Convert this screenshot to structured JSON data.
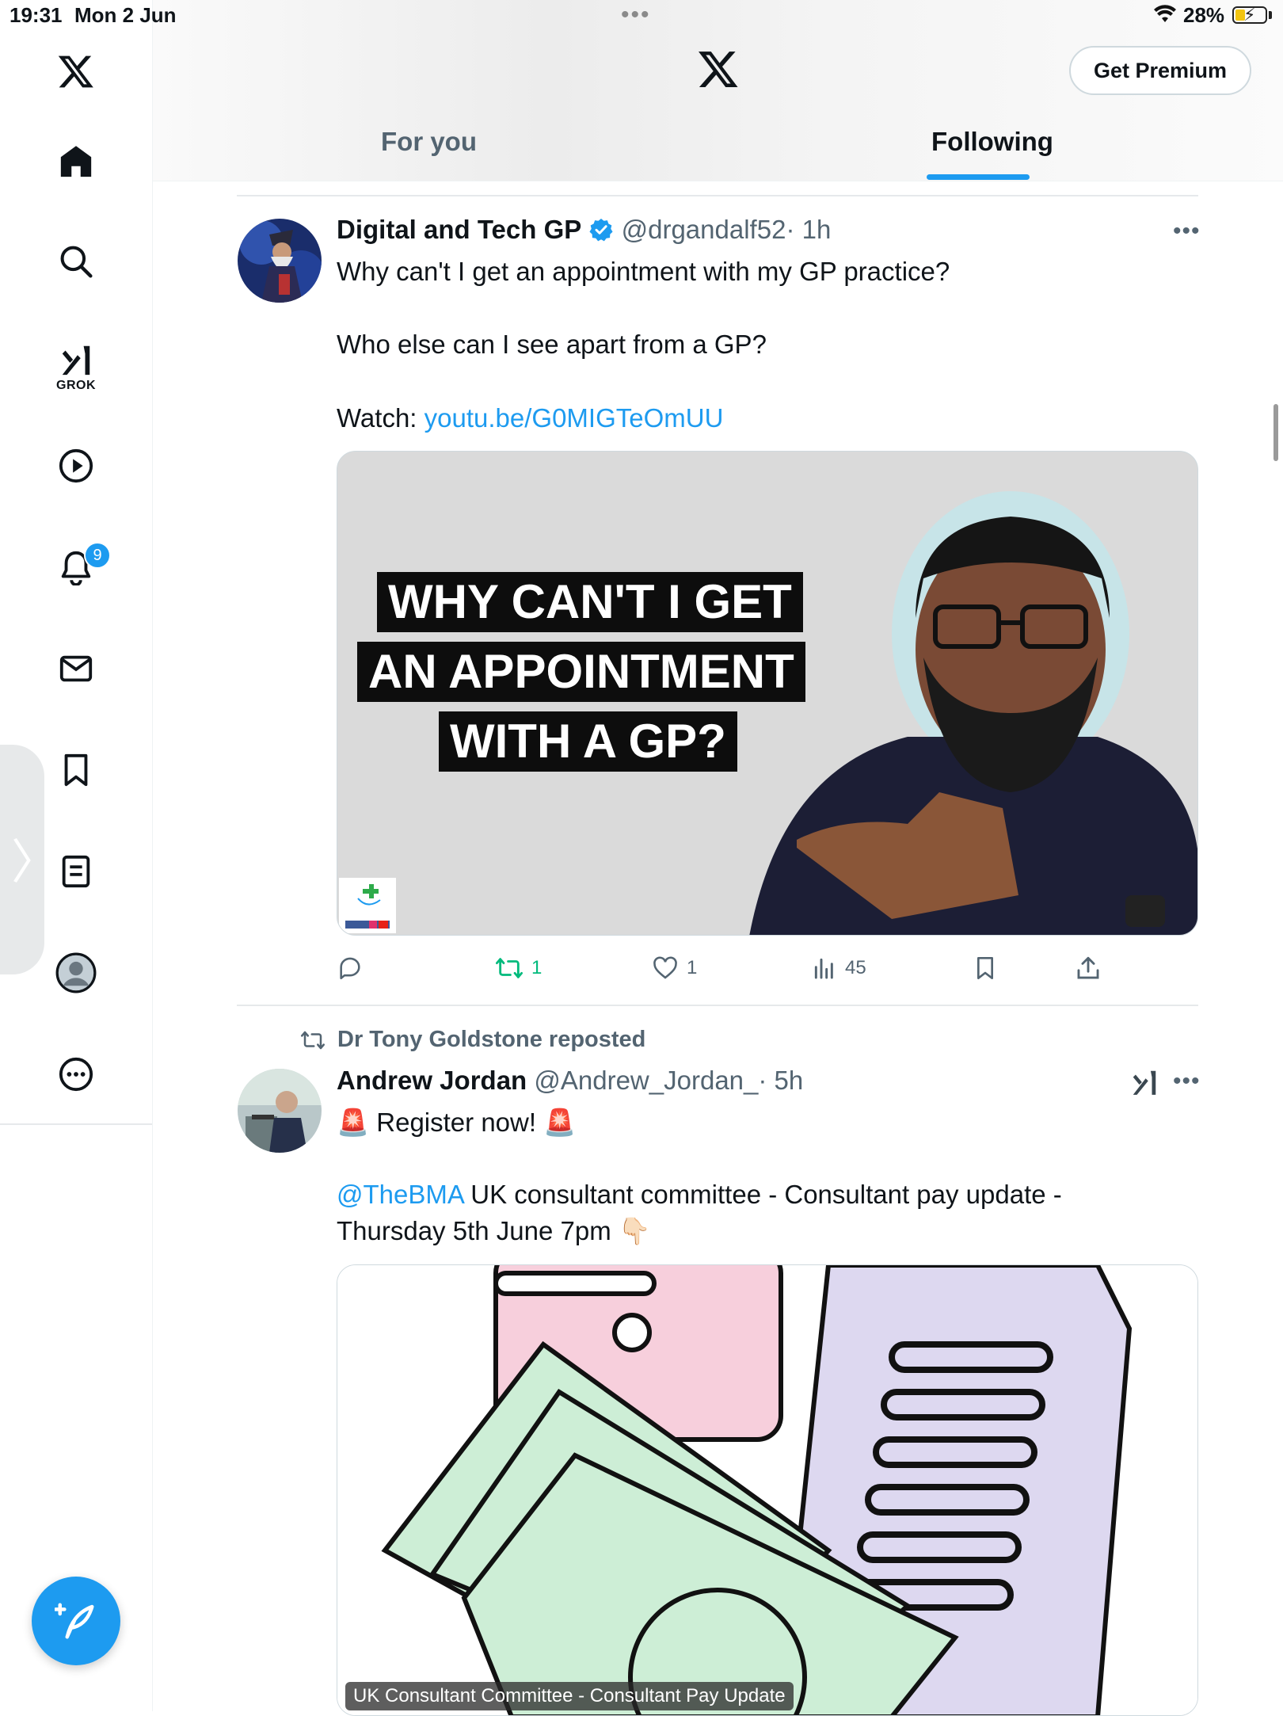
{
  "status_bar": {
    "time": "19:31",
    "date": "Mon 2 Jun",
    "battery": "28%"
  },
  "sidebar": {
    "items": [
      {
        "name": "x-logo-icon"
      },
      {
        "name": "home-icon"
      },
      {
        "name": "search-icon"
      },
      {
        "name": "grok-icon",
        "label": "GROK"
      },
      {
        "name": "video-icon"
      },
      {
        "name": "notifications-icon",
        "badge": "9"
      },
      {
        "name": "messages-icon"
      },
      {
        "name": "bookmarks-icon"
      },
      {
        "name": "lists-icon"
      },
      {
        "name": "profile-icon"
      },
      {
        "name": "more-icon"
      }
    ],
    "compose_icon": "compose-post-icon"
  },
  "header": {
    "premium_label": "Get Premium",
    "tabs": [
      {
        "label": "For you",
        "active": false
      },
      {
        "label": "Following",
        "active": true
      }
    ]
  },
  "posts": [
    {
      "author": "Digital and Tech GP",
      "verified": true,
      "handle": "@drgandalf52",
      "time": "· 1h",
      "line1": "Why can't I get an appointment with my GP practice?",
      "line2": "Who else can I see apart from a GP?",
      "watch_label": "Watch: ",
      "link": "youtu.be/G0MIGTeOmUU",
      "thumbnail_text": [
        "WHY CAN'T I GET",
        "AN APPOINTMENT",
        "WITH A GP?"
      ],
      "stats": {
        "reposts": "1",
        "likes": "1",
        "views": "45"
      }
    },
    {
      "reposted_by": "Dr Tony Goldstone reposted",
      "author": "Andrew Jordan",
      "handle": "@Andrew_Jordan_",
      "time": "· 5h",
      "line1_text": "Register now!",
      "mention": "@TheBMA",
      "line2_rest": " UK consultant committee - Consultant pay update -",
      "line3": "Thursday 5th June 7pm",
      "media_caption": "UK Consultant Committee - Consultant Pay Update"
    }
  ],
  "colors": {
    "accent": "#1d9bf0",
    "text": "#0f1419",
    "secondary": "#536471",
    "repost_green": "#00ba7c"
  }
}
